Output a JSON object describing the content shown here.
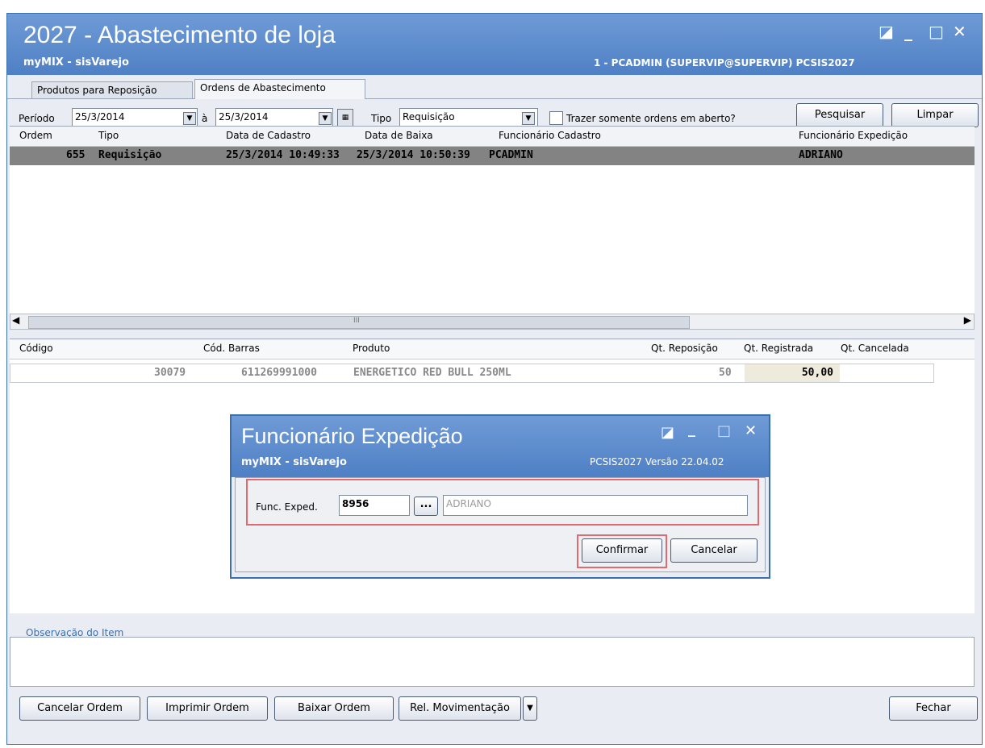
{
  "window": {
    "title": "2027 - Abastecimento de loja",
    "subtitle": "myMIX - sisVarejo",
    "user_info": "1 - PCADMIN (SUPERVIP@SUPERVIP)  PCSIS2027",
    "controls": [
      "◪",
      "_",
      "□",
      "✕"
    ]
  },
  "tabs": [
    {
      "label": "Produtos para Reposição"
    },
    {
      "label": "Ordens de Abastecimento"
    }
  ],
  "filter": {
    "periodo_label": "Período",
    "date_from": "25/3/2014",
    "a_label": "à",
    "date_to": "25/3/2014",
    "tipo_label": "Tipo",
    "tipo_value": "Requisição",
    "open_orders_label": "Trazer somente ordens em aberto?",
    "pesquisar": "Pesquisar",
    "limpar": "Limpar"
  },
  "orders_grid": {
    "columns": [
      "Ordem",
      "Tipo",
      "Data de Cadastro",
      "Data de Baixa",
      "Funcionário Cadastro",
      "Funcionário Expedição"
    ],
    "row": {
      "ordem": "655",
      "tipo": "Requisição",
      "data_cadastro": "25/3/2014 10:49:33",
      "data_baixa": "25/3/2014 10:50:39",
      "func_cadastro": "PCADMIN",
      "func_expedicao": "ADRIANO"
    },
    "scroll_mark": "III"
  },
  "items_grid": {
    "columns": [
      "Código",
      "Cód. Barras",
      "Produto",
      "Qt. Reposição",
      "Qt. Registrada",
      "Qt. Cancelada"
    ],
    "row": {
      "codigo": "30079",
      "cod_barras": "611269991000",
      "produto": "ENERGETICO RED BULL 250ML",
      "qt_reposicao": "50",
      "qt_registrada": "50,00",
      "qt_cancelada": ""
    }
  },
  "observacao_label": "Observação do Item",
  "footer": {
    "cancelar_ordem": "Cancelar Ordem",
    "imprimir_ordem": "Imprimir Ordem",
    "baixar_ordem": "Baixar Ordem",
    "rel_movimentacao": "Rel. Movimentação",
    "fechar": "Fechar"
  },
  "dialog": {
    "title": "Funcionário Expedição",
    "subtitle": "myMIX - sisVarejo",
    "version": "PCSIS2027  Versão 22.04.02",
    "func_label": "Func. Exped.",
    "func_code": "8956",
    "browse": "...",
    "func_name": "ADRIANO",
    "confirmar": "Confirmar",
    "cancelar": "Cancelar"
  },
  "colors": {
    "title_bar": "#5586c9",
    "selected_row": "#838383",
    "highlight": "#e06a70"
  }
}
